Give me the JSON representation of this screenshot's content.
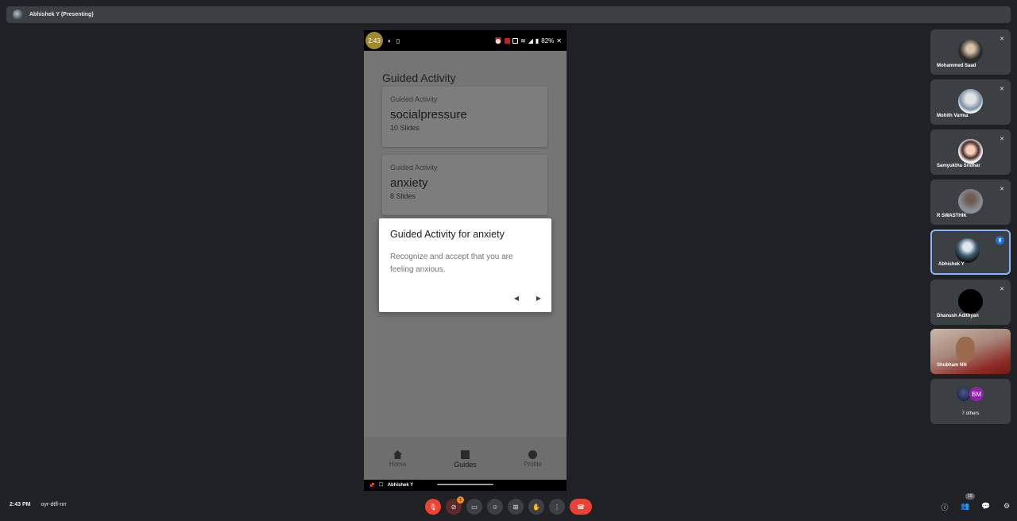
{
  "meeting": {
    "presenter_banner": "Abhishek Y (Presenting)",
    "time": "2:43 PM",
    "code": "oyr-dtfl-nrr",
    "people_count": "15"
  },
  "phone": {
    "status_time": "2:43",
    "battery": "82%",
    "heading": "Guided Activity",
    "cards": [
      {
        "label": "Guided Activity",
        "title": "socialpressure",
        "slides": "10 Slides"
      },
      {
        "label": "Guided Activity",
        "title": "anxiety",
        "slides": "8 Slides"
      }
    ],
    "nav": [
      {
        "label": "Home",
        "icon": "home-icon"
      },
      {
        "label": "Guides",
        "icon": "book-icon"
      },
      {
        "label": "Profile",
        "icon": "profile-icon"
      }
    ],
    "footer_name": "Abhishek Y"
  },
  "dialog": {
    "title": "Guided Activity for anxiety",
    "body": "Recognize and accept that you are feeling anxious.",
    "prev": "◀",
    "next": "▶"
  },
  "participants": [
    {
      "name": "Mohammed Saad",
      "muted": true
    },
    {
      "name": "Mohith Varma",
      "muted": true
    },
    {
      "name": "Samyuktha Sridhar",
      "muted": true
    },
    {
      "name": "R SWASTHIK",
      "muted": true
    },
    {
      "name": "Abhishek Y",
      "speaking": true
    },
    {
      "name": "Dhanush Adithyan",
      "muted": true
    },
    {
      "name": "Shubham NN",
      "video": true
    }
  ],
  "others": {
    "initials": "BM",
    "label": "7 others"
  },
  "controls": {
    "chat_badge": "1"
  },
  "colors": {
    "background": "#202124",
    "tile": "#3c4043",
    "end_call": "#ea4335",
    "active_border": "#8ab4f8"
  }
}
